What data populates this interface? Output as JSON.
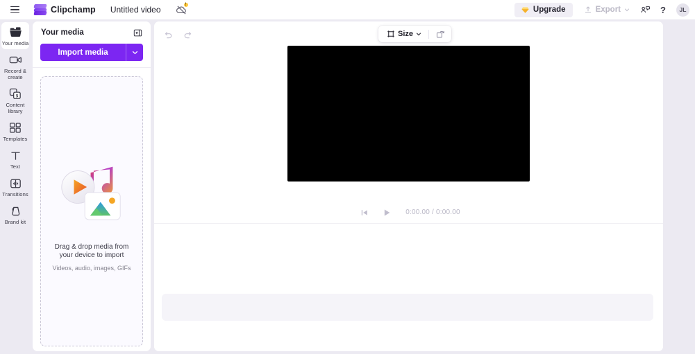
{
  "app": {
    "brand_name": "Clipchamp",
    "project_title": "Untitled video",
    "accent_purple": "#7c26f2",
    "canvas_bg": "#eceaf2",
    "preview_bg": "#000000"
  },
  "topbar": {
    "menu_icon": "hamburger-menu-icon",
    "logo_icon": "clipchamp-logo-icon",
    "sync_icon": "cloud-sync-off-icon",
    "sync_badge": "!",
    "upgrade_label": "Upgrade",
    "upgrade_icon": "diamond-icon",
    "export_label": "Export",
    "export_icon": "upload-arrow-icon",
    "export_caret": "chevron-down-icon",
    "share_icon": "collaborate-people-icon",
    "help_label": "?",
    "avatar_initials": "JL"
  },
  "sidebar": {
    "items": [
      {
        "label": "Your media",
        "icon": "folder-media-icon",
        "active": true
      },
      {
        "label": "Record & create",
        "icon": "video-camera-icon",
        "active": false
      },
      {
        "label": "Content library",
        "icon": "content-library-icon",
        "active": false
      },
      {
        "label": "Templates",
        "icon": "templates-grid-icon",
        "active": false
      },
      {
        "label": "Text",
        "icon": "text-t-icon",
        "active": false
      },
      {
        "label": "Transitions",
        "icon": "transitions-icon",
        "active": false
      },
      {
        "label": "Brand kit",
        "icon": "brand-kit-icon",
        "active": false
      }
    ]
  },
  "media_panel": {
    "title": "Your media",
    "collapse_icon": "collapse-panel-icon",
    "import_label": "Import media",
    "import_caret_icon": "chevron-down-icon",
    "dropzone": {
      "art_icon": "media-types-illustration",
      "headline": "Drag & drop media from your device to import",
      "subtext": "Videos, audio, images, GIFs"
    }
  },
  "stage": {
    "undo_icon": "undo-arrow-icon",
    "redo_icon": "redo-arrow-icon",
    "size_toolbar": {
      "crop_icon": "crop-frame-icon",
      "size_label": "Size",
      "caret_icon": "chevron-down-icon",
      "rotate_icon": "rotate-media-icon"
    },
    "transport": {
      "skip_start_icon": "skip-to-start-icon",
      "play_icon": "play-icon",
      "time_display": "0:00.00 / 0:00.00"
    },
    "timeline": {
      "empty_track_label": ""
    }
  }
}
